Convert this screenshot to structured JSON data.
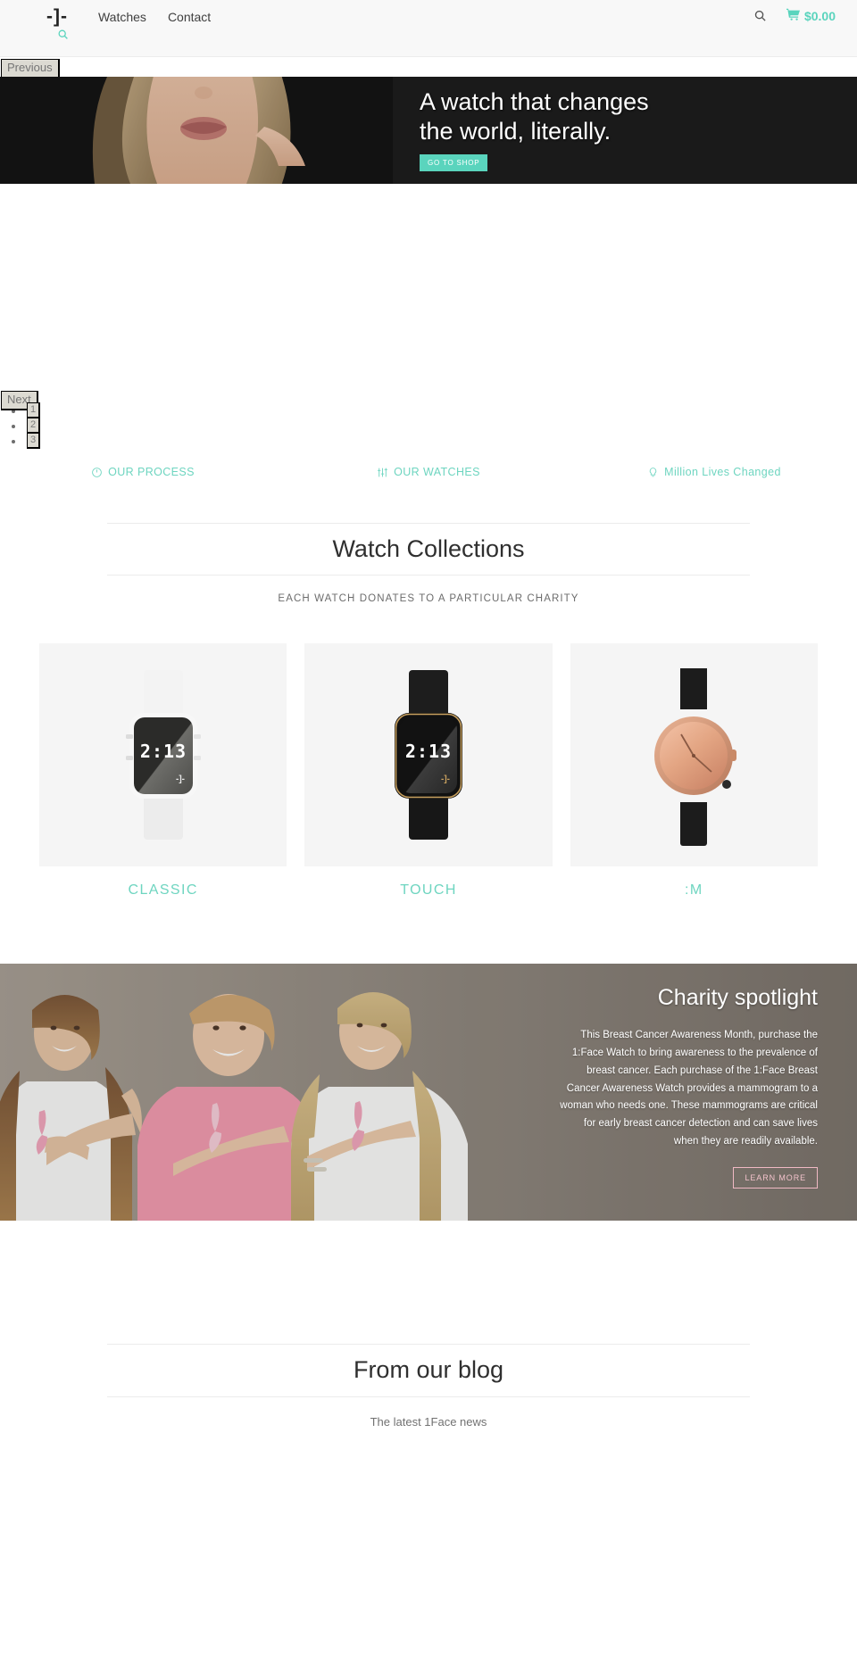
{
  "header": {
    "logo": "-]-",
    "nav": [
      {
        "label": "Watches"
      },
      {
        "label": "Contact"
      }
    ],
    "search_icon": "search-icon",
    "cart_icon": "shopping-cart-icon",
    "cart_total": "$0.00"
  },
  "slider": {
    "previous_label": "Previous",
    "next_label": "Next",
    "dots": [
      "1",
      "2",
      "3"
    ],
    "slide": {
      "title_line1": "A watch that changes",
      "title_line2": "the world, literally.",
      "cta_label": "GO TO SHOP"
    }
  },
  "features": [
    {
      "icon": "clock-icon",
      "label": "OUR PROCESS"
    },
    {
      "icon": "sliders-icon",
      "label": "OUR WATCHES"
    },
    {
      "icon": "lightbulb-icon",
      "label": "Million Lives Changed"
    }
  ],
  "collections": {
    "title": "Watch Collections",
    "subtitle": "EACH WATCH DONATES TO A PARTICULAR CHARITY",
    "items": [
      {
        "name": "CLASSIC",
        "style": "white-square-digital",
        "display_time": "2:13",
        "face_logo": "-]-"
      },
      {
        "name": "TOUCH",
        "style": "black-square-digital",
        "display_time": "2:13",
        "face_logo": "-]-"
      },
      {
        "name": ":M",
        "style": "rose-gold-analog",
        "display_time": "",
        "face_logo": ""
      }
    ]
  },
  "charity": {
    "title": "Charity spotlight",
    "body": "This Breast Cancer Awareness Month, purchase the 1:Face Watch to bring awareness to the prevalence of breast cancer. Each purchase of the 1:Face Breast Cancer Awareness Watch provides a mammogram to a woman who needs one. These mammograms are critical for early breast cancer detection and can save lives when they are readily available.",
    "cta_label": "LEARN MORE"
  },
  "blog": {
    "title": "From our blog",
    "subtitle": "The latest 1Face news"
  },
  "colors": {
    "accent": "#5ad4bd",
    "accent_light": "#6ed5c0",
    "hero_bg": "#1a1a1a",
    "pink": "#f0b9c4",
    "header_bg": "#f8f8f8"
  }
}
